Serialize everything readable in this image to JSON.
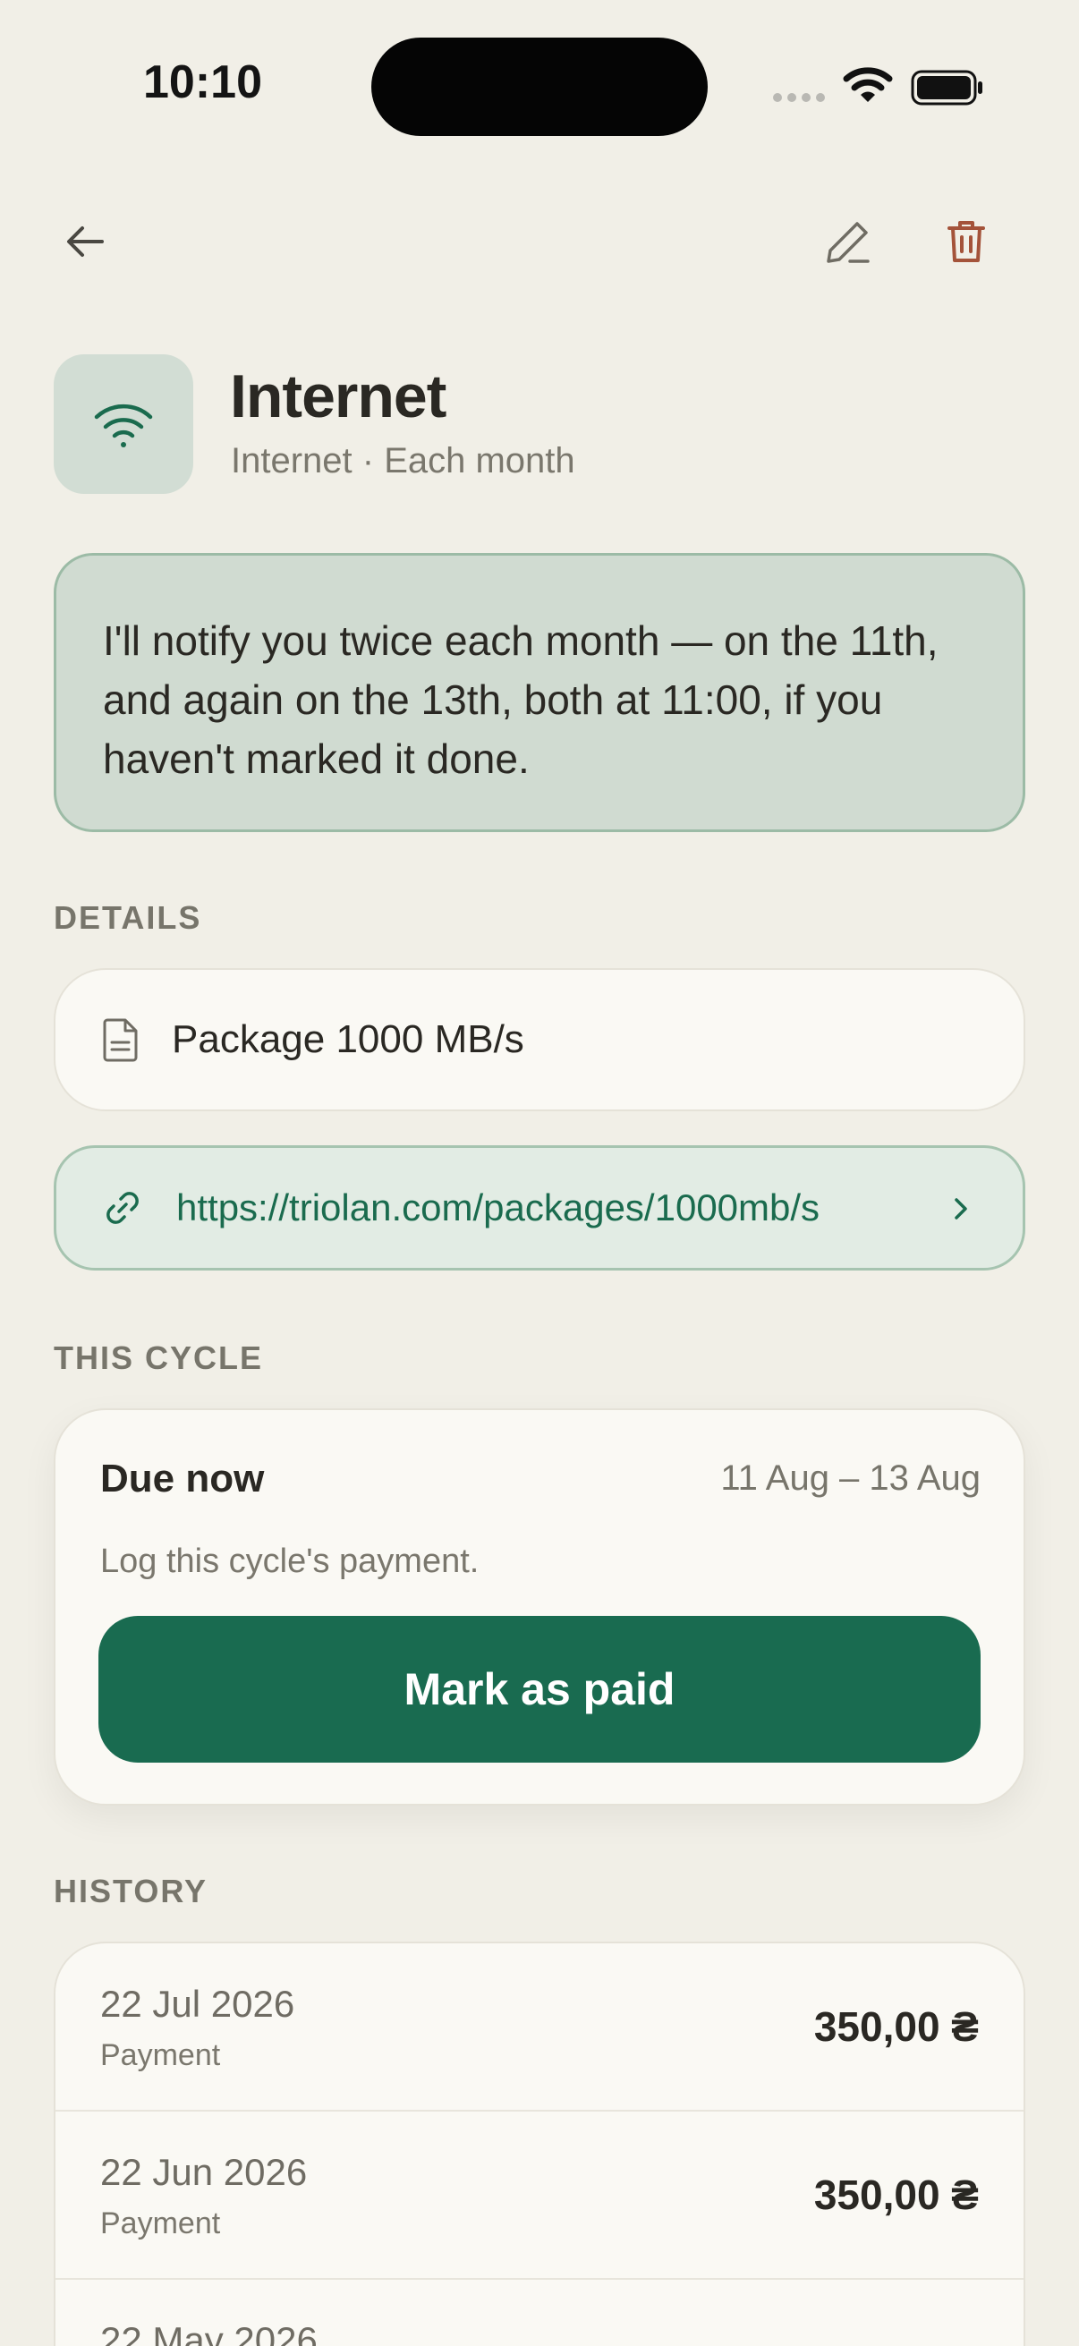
{
  "status_bar": {
    "time": "10:10"
  },
  "header": {
    "title": "Internet",
    "subtitle": "Internet · Each month",
    "icon": "wifi-icon"
  },
  "notice": {
    "line1": "I'll notify you twice each month — on the 11th,",
    "line2": "and again on the 13th, both at 11:00, if you",
    "line3": "haven't marked it done."
  },
  "details": {
    "label": "DETAILS",
    "note": "Package 1000 MB/s",
    "link": "https://triolan.com/packages/1000mb/s"
  },
  "cycle": {
    "label": "THIS CYCLE",
    "status": "Due now",
    "range": "11 Aug – 13 Aug",
    "hint": "Log this cycle's payment.",
    "button": "Mark as paid"
  },
  "history": {
    "label": "HISTORY",
    "items": [
      {
        "date": "22 Jul 2026",
        "kind": "Payment",
        "amount": "350,00 ₴"
      },
      {
        "date": "22 Jun 2026",
        "kind": "Payment",
        "amount": "350,00 ₴"
      },
      {
        "date": "22 May 2026",
        "kind": "",
        "amount": ""
      }
    ]
  },
  "colors": {
    "background": "#f1efe7",
    "accent": "#196b50",
    "danger": "#a4533a",
    "banner": "#d0dbd1"
  }
}
